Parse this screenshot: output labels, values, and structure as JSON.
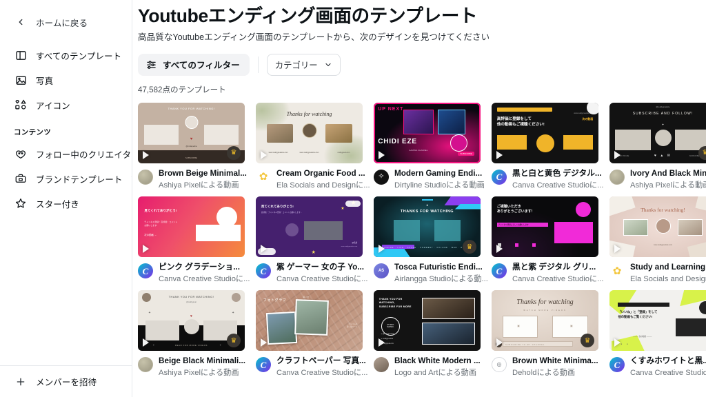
{
  "sidebar": {
    "back_label": "ホームに戻る",
    "items": [
      {
        "label": "すべてのテンプレート",
        "icon": "layout-icon"
      },
      {
        "label": "写真",
        "icon": "image-icon"
      },
      {
        "label": "アイコン",
        "icon": "shapes-icon"
      }
    ],
    "group_title": "コンテンツ",
    "content_items": [
      {
        "label": "フォロー中のクリエイター",
        "icon": "heart-people-icon",
        "badge": ""
      },
      {
        "label": "ブランドテンプレート",
        "icon": "briefcase-icon",
        "badge": "♛"
      },
      {
        "label": "スター付き",
        "icon": "star-icon",
        "badge": ""
      }
    ],
    "footer_label": "メンバーを招待",
    "footer_icon": "plus-icon"
  },
  "header": {
    "title": "Youtubeエンディング画面のテンプレート",
    "subtitle": "高品質なYoutubeエンディング画面のテンプレートから、次のデザインを見つけてください",
    "filter_button": "すべてのフィルター",
    "filter_icon": "sliders-icon",
    "category_button": "カテゴリー",
    "category_icon": "chevron-down-icon",
    "count_label": "47,582点のテンプレート"
  },
  "templates": [
    {
      "name": "Brown Beige Minimal...",
      "author": "Ashiya Pixelによる動画",
      "avatar": "gold-seal",
      "avatar_color": "#a9a691",
      "premium": true,
      "style": "brown-beige"
    },
    {
      "name": "Cream Organic Food ...",
      "author": "Ela Socials and Designに...",
      "avatar": "yellow-blob",
      "avatar_color": "#f5c93f",
      "premium": false,
      "style": "cream-organic"
    },
    {
      "name": "Modern Gaming Endi...",
      "author": "Dirtyline Studioによる動画",
      "avatar": "black-swirl",
      "avatar_color": "#141414",
      "premium": false,
      "style": "gaming-pink"
    },
    {
      "name": "黒と白と黄色 デジタル...",
      "author": "Canva Creative Studioに...",
      "avatar": "canva-c",
      "avatar_color": "#00c4cc",
      "premium": false,
      "style": "black-yellow"
    },
    {
      "name": "Ivory And Black Min...",
      "author": "Ashiya Pixelによる動画",
      "avatar": "gold-seal",
      "avatar_color": "#a9a691",
      "premium": true,
      "style": "ivory-black"
    },
    {
      "name": "ピンク グラデーショ...",
      "author": "Canva Creative Studioに...",
      "avatar": "canva-c",
      "avatar_color": "#00c4cc",
      "premium": false,
      "style": "pink-gradient"
    },
    {
      "name": "紫 ゲーマー 女の子 Yo...",
      "author": "Canva Creative Studioに...",
      "avatar": "canva-c",
      "avatar_color": "#00c4cc",
      "premium": false,
      "style": "purple-gamer"
    },
    {
      "name": "Tosca Futuristic Endi...",
      "author": "Airlangga Studioによる動...",
      "avatar": "blue-circle",
      "avatar_color": "#6b74d8",
      "premium": true,
      "style": "tosca-futuristic"
    },
    {
      "name": "黒と紫 デジタル グリ...",
      "author": "Canva Creative Studioに...",
      "avatar": "canva-c",
      "avatar_color": "#00c4cc",
      "premium": false,
      "style": "black-purple"
    },
    {
      "name": "Study and Learning",
      "author": "Ela Socials and Designに",
      "avatar": "yellow-blob",
      "avatar_color": "#f5c93f",
      "premium": false,
      "style": "study-learning"
    },
    {
      "name": "Beige Black Minimali...",
      "author": "Ashiya Pixelによる動画",
      "avatar": "gold-seal",
      "avatar_color": "#a9a691",
      "premium": true,
      "style": "beige-black"
    },
    {
      "name": "クラフトペーパー 写真...",
      "author": "Canva Creative Studioに...",
      "avatar": "canva-c",
      "avatar_color": "#00c4cc",
      "premium": false,
      "style": "craft-paper"
    },
    {
      "name": "Black White Modern ...",
      "author": "Logo and Artによる動画",
      "avatar": "photo-circle",
      "avatar_color": "#8a7d72",
      "premium": false,
      "style": "black-white-modern"
    },
    {
      "name": "Brown White Minima...",
      "author": "Deholdによる動画",
      "avatar": "ring-circle",
      "avatar_color": "#ffffff",
      "premium": true,
      "style": "brown-white"
    },
    {
      "name": "くすみホワイトと黒...",
      "author": "Canva Creative Studioに",
      "avatar": "canva-c",
      "avatar_color": "#00c4cc",
      "premium": false,
      "style": "white-black-neon"
    }
  ],
  "colors": {
    "accent": "#00c4cc",
    "text": "#0d1216",
    "muted": "#6b7278",
    "chip_bg": "#f2f3f5",
    "border": "#e6e9ec",
    "crown": "#f4c028"
  }
}
